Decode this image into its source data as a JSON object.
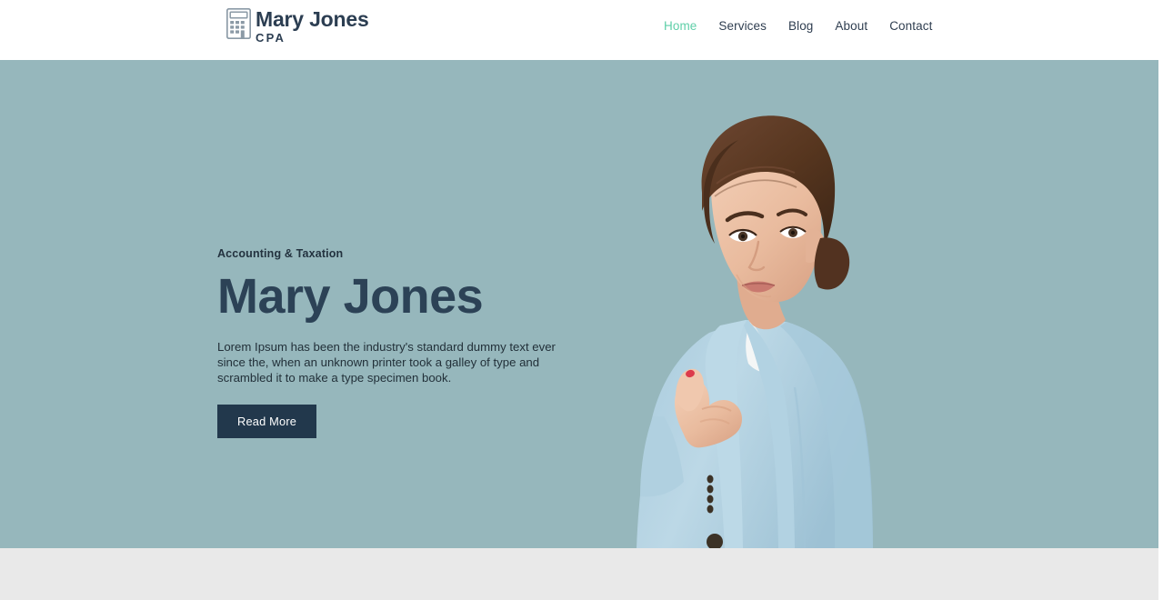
{
  "header": {
    "brand": {
      "icon": "calculator-icon",
      "name": "Mary Jones",
      "subtitle": "CPA"
    },
    "nav": [
      {
        "label": "Home",
        "active": true
      },
      {
        "label": "Services",
        "active": false
      },
      {
        "label": "Blog",
        "active": false
      },
      {
        "label": "About",
        "active": false
      },
      {
        "label": "Contact",
        "active": false
      }
    ]
  },
  "hero": {
    "eyebrow": "Accounting & Taxation",
    "title": "Mary Jones",
    "description": "Lorem Ipsum has been the industry's standard dummy text ever since the, when an unknown printer took a galley of type and scrambled it to make a type specimen book.",
    "cta_label": "Read More",
    "image_alt": "businesswoman-pointing-photo"
  },
  "colors": {
    "hero_background": "#96b7bc",
    "nav_active": "#5fcfa8",
    "nav_default": "#2f3e50",
    "heading": "#2c4256",
    "button_background": "#22384c",
    "button_text": "#ffffff",
    "lower_section": "#e9e9e9",
    "header_background": "#ffffff"
  }
}
